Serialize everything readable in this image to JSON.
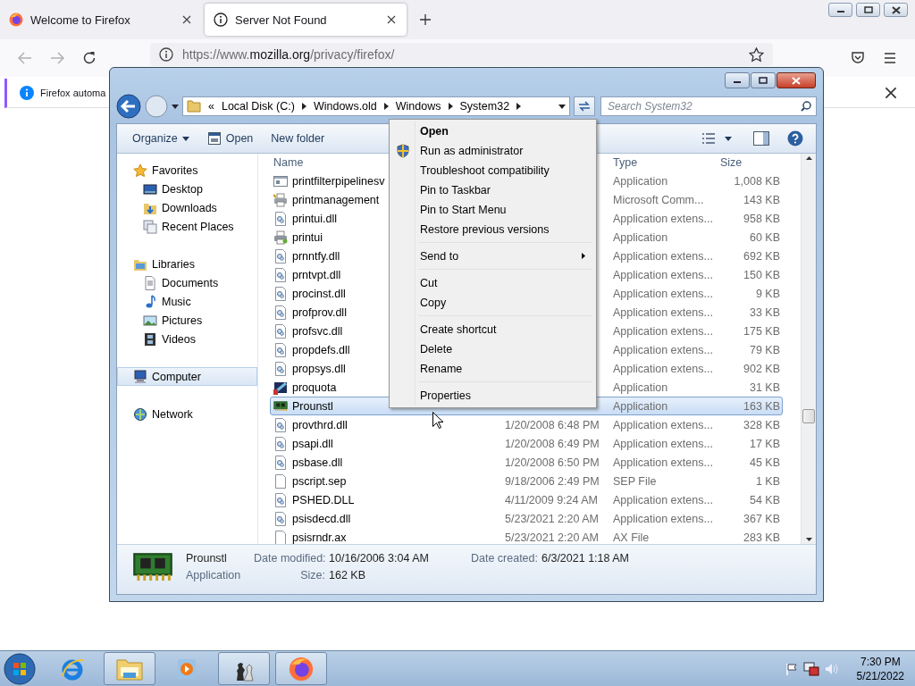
{
  "browser": {
    "tabs": [
      {
        "label": "Welcome to Firefox",
        "selected": false
      },
      {
        "label": "Server Not Found",
        "selected": true
      }
    ],
    "url": {
      "scheme": "https://www.",
      "host": "mozilla.org",
      "path": "/privacy/firefox/"
    },
    "notification": "Firefox automa"
  },
  "explorer": {
    "breadcrumbs": [
      "«",
      "Local Disk (C:)",
      "Windows.old",
      "Windows",
      "System32"
    ],
    "search": {
      "placeholder": "Search System32"
    },
    "toolbar": [
      "Organize",
      "Open",
      "New folder"
    ],
    "sidebar": [
      {
        "label": "Favorites",
        "kind": "favorites",
        "selected": false,
        "children": [
          {
            "label": "Desktop",
            "kind": "desktop",
            "selected": false
          },
          {
            "label": "Downloads",
            "kind": "downloads",
            "selected": false
          },
          {
            "label": "Recent Places",
            "kind": "recent",
            "selected": false
          }
        ]
      },
      {
        "label": "Libraries",
        "kind": "libraries",
        "selected": false,
        "children": [
          {
            "label": "Documents",
            "kind": "documents",
            "selected": false
          },
          {
            "label": "Music",
            "kind": "music",
            "selected": false
          },
          {
            "label": "Pictures",
            "kind": "pictures",
            "selected": false
          },
          {
            "label": "Videos",
            "kind": "videos",
            "selected": false
          }
        ]
      },
      {
        "label": "Computer",
        "kind": "computer",
        "selected": true
      },
      {
        "label": "Network",
        "kind": "network",
        "selected": false
      }
    ],
    "columns": {
      "name": "Name",
      "type": "Type",
      "size": "Size"
    },
    "rows": [
      {
        "name": "printfilterpipelinesv",
        "kind": "service",
        "type": "Application",
        "size": "1,008 KB",
        "selected": false
      },
      {
        "name": "printmanagement",
        "kind": "console",
        "type": "Microsoft Comm...",
        "size": "143 KB",
        "selected": false
      },
      {
        "name": "printui.dll",
        "kind": "dll",
        "type": "Application extens...",
        "size": "958 KB",
        "selected": false
      },
      {
        "name": "printui",
        "kind": "printer",
        "type": "Application",
        "size": "60 KB",
        "selected": false
      },
      {
        "name": "prnntfy.dll",
        "kind": "dll",
        "type": "Application extens...",
        "size": "692 KB",
        "selected": false
      },
      {
        "name": "prntvpt.dll",
        "kind": "dll",
        "type": "Application extens...",
        "size": "150 KB",
        "selected": false
      },
      {
        "name": "procinst.dll",
        "kind": "dll",
        "type": "Application extens...",
        "size": "9 KB",
        "selected": false
      },
      {
        "name": "profprov.dll",
        "kind": "dll",
        "type": "Application extens...",
        "size": "33 KB",
        "selected": false
      },
      {
        "name": "profsvc.dll",
        "kind": "dll",
        "type": "Application extens...",
        "size": "175 KB",
        "selected": false
      },
      {
        "name": "propdefs.dll",
        "kind": "dll",
        "type": "Application extens...",
        "size": "79 KB",
        "selected": false
      },
      {
        "name": "propsys.dll",
        "kind": "dll",
        "type": "Application extens...",
        "size": "902 KB",
        "selected": false
      },
      {
        "name": "proquota",
        "kind": "quota",
        "type": "Application",
        "size": "31 KB",
        "selected": false
      },
      {
        "name": "Prounstl",
        "kind": "chip",
        "type": "Application",
        "size": "163 KB",
        "selected": true
      },
      {
        "name": "provthrd.dll",
        "kind": "dll",
        "date": "1/20/2008 6:48 PM",
        "type": "Application extens...",
        "size": "328 KB",
        "selected": false
      },
      {
        "name": "psapi.dll",
        "kind": "dll",
        "date": "1/20/2008 6:49 PM",
        "type": "Application extens...",
        "size": "17 KB",
        "selected": false
      },
      {
        "name": "psbase.dll",
        "kind": "dll",
        "date": "1/20/2008 6:50 PM",
        "type": "Application extens...",
        "size": "45 KB",
        "selected": false
      },
      {
        "name": "pscript.sep",
        "kind": "file",
        "date": "9/18/2006 2:49 PM",
        "type": "SEP File",
        "size": "1 KB",
        "selected": false
      },
      {
        "name": "PSHED.DLL",
        "kind": "dll",
        "date": "4/11/2009 9:24 AM",
        "type": "Application extens...",
        "size": "54 KB",
        "selected": false
      },
      {
        "name": "psisdecd.dll",
        "kind": "dll",
        "date": "5/23/2021 2:20 AM",
        "type": "Application extens...",
        "size": "367 KB",
        "selected": false
      },
      {
        "name": "psisrndr.ax",
        "kind": "file",
        "date": "5/23/2021 2:20 AM",
        "type": "AX File",
        "size": "283 KB",
        "selected": false
      }
    ],
    "details": {
      "name": "Prounstl",
      "type": "Application",
      "modified_label": "Date modified:",
      "modified": "10/16/2006 3:04 AM",
      "created_label": "Date created:",
      "created": "6/3/2021 1:18 AM",
      "size_label": "Size:",
      "size": "162 KB"
    }
  },
  "context_menu": [
    [
      {
        "label": "Open",
        "default": true,
        "shield": false,
        "submenu": false
      },
      {
        "label": "Run as administrator",
        "default": false,
        "shield": true,
        "submenu": false
      },
      {
        "label": "Troubleshoot compatibility",
        "default": false,
        "shield": false,
        "submenu": false
      },
      {
        "label": "Pin to Taskbar",
        "default": false,
        "shield": false,
        "submenu": false
      },
      {
        "label": "Pin to Start Menu",
        "default": false,
        "shield": false,
        "submenu": false
      },
      {
        "label": "Restore previous versions",
        "default": false,
        "shield": false,
        "submenu": false
      }
    ],
    [
      {
        "label": "Send to",
        "default": false,
        "shield": false,
        "submenu": true
      }
    ],
    [
      {
        "label": "Cut",
        "default": false,
        "shield": false,
        "submenu": false
      },
      {
        "label": "Copy",
        "default": false,
        "shield": false,
        "submenu": false
      }
    ],
    [
      {
        "label": "Create shortcut",
        "default": false,
        "shield": false,
        "submenu": false
      },
      {
        "label": "Delete",
        "default": false,
        "shield": false,
        "submenu": false
      },
      {
        "label": "Rename",
        "default": false,
        "shield": false,
        "submenu": false
      }
    ],
    [
      {
        "label": "Properties",
        "default": false,
        "shield": false,
        "submenu": false
      }
    ]
  ],
  "taskbar": {
    "apps": [
      {
        "kind": "ie",
        "running": false
      },
      {
        "kind": "explorer",
        "running": true
      },
      {
        "kind": "media",
        "running": false
      },
      {
        "kind": "chess",
        "running": true
      },
      {
        "kind": "firefox",
        "running": true
      }
    ],
    "time": "7:30 PM",
    "date": "5/21/2022"
  }
}
